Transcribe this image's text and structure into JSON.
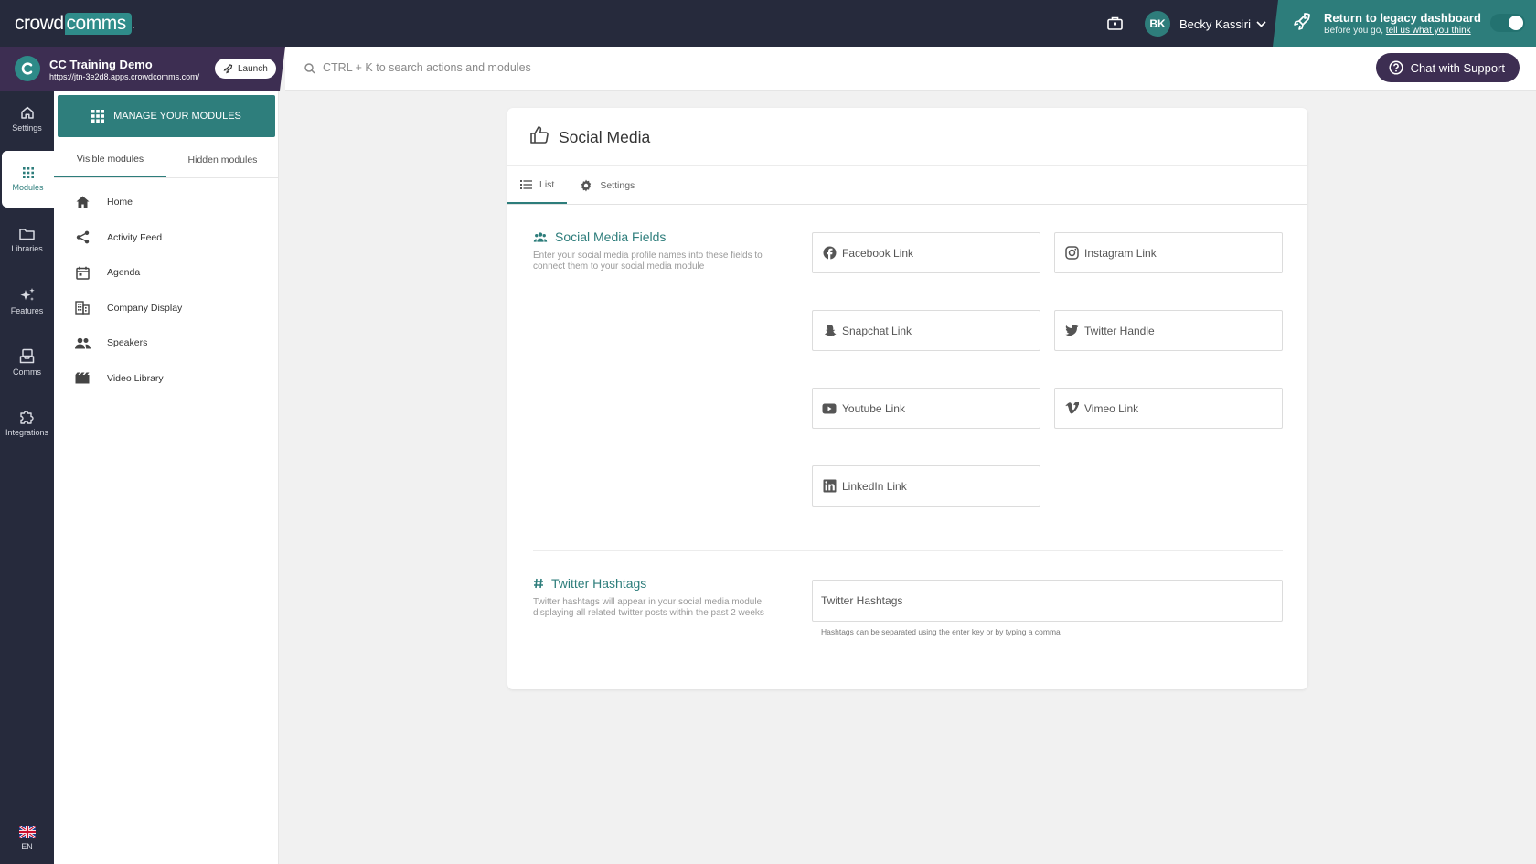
{
  "topbar": {
    "logo_text": "crowd",
    "logo_accent": "comms",
    "user_initials": "BK",
    "user_name": "Becky Kassiri",
    "legacy_title": "Return to legacy dashboard",
    "legacy_sub": "Before you go,",
    "legacy_link": "tell us what you think"
  },
  "event": {
    "name": "CC Training Demo",
    "url": "https://jtn-3e2d8.apps.crowdcomms.com/",
    "launch_label": "Launch"
  },
  "search": {
    "placeholder": "CTRL + K to search actions and modules"
  },
  "support": {
    "label": "Chat with Support"
  },
  "rail": {
    "items": [
      {
        "label": "Settings",
        "icon": "home-icon"
      },
      {
        "label": "Modules",
        "icon": "grid-icon"
      },
      {
        "label": "Libraries",
        "icon": "folder-icon"
      },
      {
        "label": "Features",
        "icon": "sparkle-icon"
      },
      {
        "label": "Comms",
        "icon": "inbox-icon"
      },
      {
        "label": "Integrations",
        "icon": "puzzle-icon"
      }
    ],
    "language": "EN"
  },
  "modules_panel": {
    "manage_label": "MANAGE YOUR MODULES",
    "tabs": [
      "Visible modules",
      "Hidden modules"
    ],
    "items": [
      {
        "label": "Home",
        "icon": "home-icon"
      },
      {
        "label": "Activity Feed",
        "icon": "share-icon"
      },
      {
        "label": "Agenda",
        "icon": "calendar-icon"
      },
      {
        "label": "Company Display",
        "icon": "building-icon"
      },
      {
        "label": "Speakers",
        "icon": "people-icon"
      },
      {
        "label": "Video Library",
        "icon": "film-icon"
      }
    ]
  },
  "card": {
    "title": "Social Media",
    "tabs": [
      "List",
      "Settings"
    ],
    "social_fields": {
      "title": "Social Media Fields",
      "description": "Enter your social media profile names into these fields to connect them to your social media module",
      "fields": [
        {
          "placeholder": "Facebook Link",
          "icon": "facebook-icon"
        },
        {
          "placeholder": "Instagram Link",
          "icon": "instagram-icon"
        },
        {
          "placeholder": "Snapchat Link",
          "icon": "snapchat-icon"
        },
        {
          "placeholder": "Twitter Handle",
          "icon": "twitter-icon"
        },
        {
          "placeholder": "Youtube Link",
          "icon": "youtube-icon"
        },
        {
          "placeholder": "Vimeo Link",
          "icon": "vimeo-icon"
        },
        {
          "placeholder": "LinkedIn Link",
          "icon": "linkedin-icon"
        }
      ]
    },
    "hashtags": {
      "title": "Twitter Hashtags",
      "description": "Twitter hashtags will appear in your social media module, displaying all related twitter posts within the past 2 weeks",
      "placeholder": "Twitter Hashtags",
      "hint": "Hashtags can be separated using the enter key or by typing a comma"
    }
  },
  "colors": {
    "accent": "#2d7d7b",
    "nav": "#262a3c",
    "event": "#3d2e52"
  }
}
